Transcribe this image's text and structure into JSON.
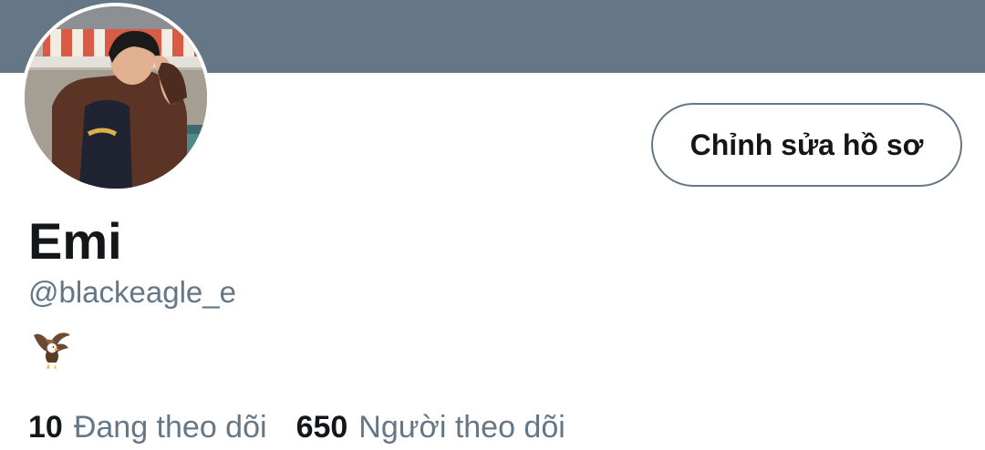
{
  "profile": {
    "display_name": "Emi",
    "handle": "@blackeagle_e",
    "bio_icon": "eagle-icon"
  },
  "actions": {
    "edit_profile_label": "Chỉnh sửa hồ sơ"
  },
  "stats": {
    "following_count": "10",
    "following_label": "Đang theo dõi",
    "followers_count": "650",
    "followers_label": "Người theo dõi"
  },
  "colors": {
    "banner": "#657786",
    "text_primary": "#14171a",
    "text_secondary": "#657786",
    "button_border": "#657786"
  }
}
